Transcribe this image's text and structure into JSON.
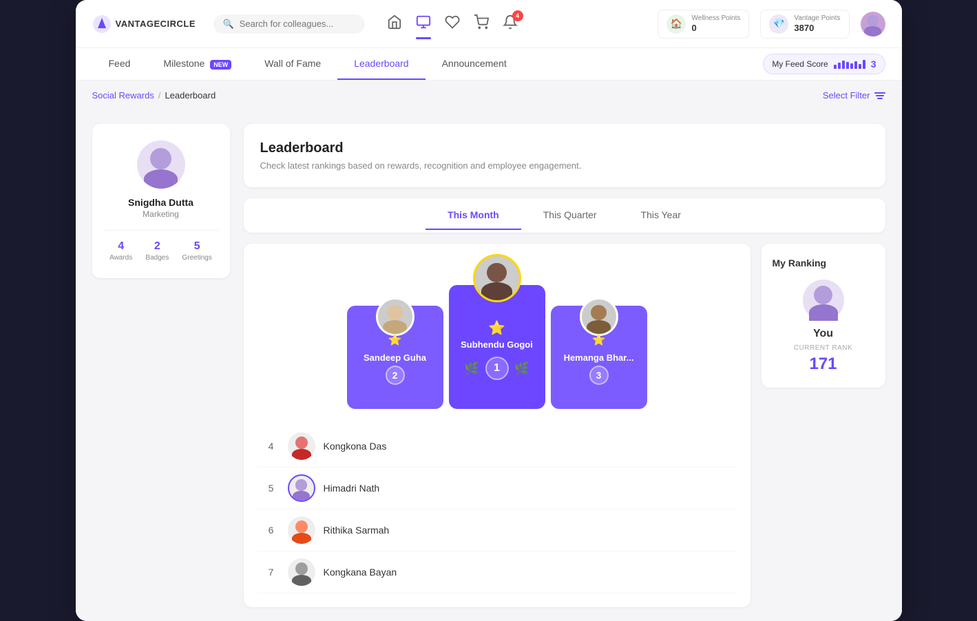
{
  "app": {
    "logo_text": "VANTAGECIRCLE"
  },
  "header": {
    "search_placeholder": "Search for colleagues...",
    "notification_count": "4",
    "wellness": {
      "label": "Wellness Points",
      "value": "0"
    },
    "vantage": {
      "label": "Vantage Points",
      "value": "3870"
    }
  },
  "nav_tabs": [
    {
      "id": "feed",
      "label": "Feed",
      "active": false
    },
    {
      "id": "milestone",
      "label": "Milestone",
      "badge": "NEW",
      "active": false
    },
    {
      "id": "wall-of-fame",
      "label": "Wall of Fame",
      "active": false
    },
    {
      "id": "leaderboard",
      "label": "Leaderboard",
      "active": true
    },
    {
      "id": "announcement",
      "label": "Announcement",
      "active": false
    }
  ],
  "feed_score": {
    "label": "My Feed Score",
    "value": "3"
  },
  "breadcrumb": {
    "parent": "Social Rewards",
    "separator": "/",
    "current": "Leaderboard"
  },
  "select_filter": "Select Filter",
  "profile": {
    "name": "Snigdha Dutta",
    "department": "Marketing",
    "stats": [
      {
        "value": "4",
        "label": "Awards"
      },
      {
        "value": "2",
        "label": "Badges"
      },
      {
        "value": "5",
        "label": "Greetings"
      }
    ]
  },
  "leaderboard": {
    "title": "Leaderboard",
    "subtitle": "Check latest rankings based on rewards, recognition and employee engagement.",
    "period_tabs": [
      {
        "id": "this-month",
        "label": "This Month",
        "active": true
      },
      {
        "id": "this-quarter",
        "label": "This Quarter",
        "active": false
      },
      {
        "id": "this-year",
        "label": "This Year",
        "active": false
      }
    ],
    "top3": [
      {
        "rank": 2,
        "name": "Sandeep Guha",
        "position": "second"
      },
      {
        "rank": 1,
        "name": "Subhendu Gogoi",
        "position": "first"
      },
      {
        "rank": 3,
        "name": "Hemanga Bhar...",
        "position": "third"
      }
    ],
    "list": [
      {
        "rank": 4,
        "name": "Kongkona Das"
      },
      {
        "rank": 5,
        "name": "Himadri Nath"
      },
      {
        "rank": 6,
        "name": "Rithika Sarmah"
      },
      {
        "rank": 7,
        "name": "Kongkana Bayan"
      }
    ]
  },
  "my_ranking": {
    "title": "My Ranking",
    "you_label": "You",
    "rank_label": "CURRENT RANK",
    "rank_value": "171"
  }
}
